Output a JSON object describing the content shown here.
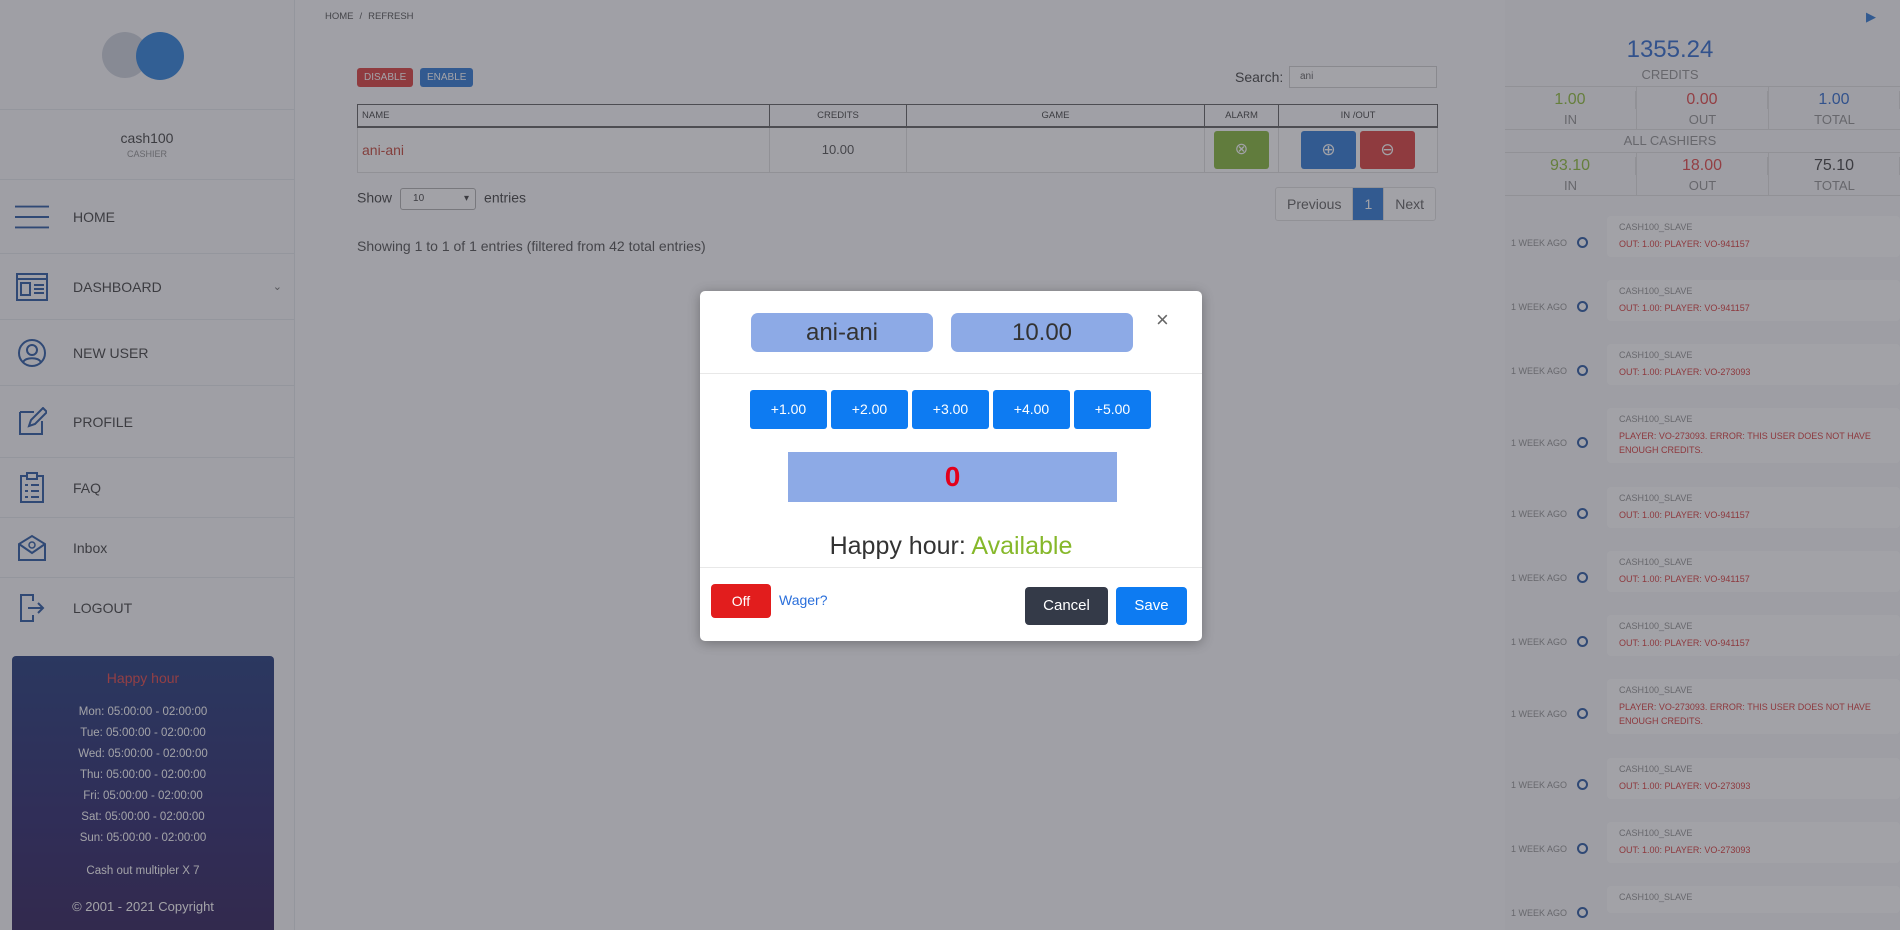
{
  "sidebar": {
    "username": "cash100",
    "role": "CASHIER",
    "nav": [
      {
        "label": "HOME",
        "icon": "menu-icon"
      },
      {
        "label": "DASHBOARD",
        "icon": "dashboard-icon"
      },
      {
        "label": "NEW USER",
        "icon": "user-icon"
      },
      {
        "label": "PROFILE",
        "icon": "edit-icon"
      },
      {
        "label": "FAQ",
        "icon": "clipboard-icon"
      },
      {
        "label": "Inbox",
        "icon": "mail-icon"
      },
      {
        "label": "LOGOUT",
        "icon": "logout-icon"
      }
    ],
    "happy_hour": {
      "title": "Happy hour",
      "days": [
        "Mon: 05:00:00 - 02:00:00",
        "Tue: 05:00:00 - 02:00:00",
        "Wed: 05:00:00 - 02:00:00",
        "Thu: 05:00:00 - 02:00:00",
        "Fri: 05:00:00 - 02:00:00",
        "Sat: 05:00:00 - 02:00:00",
        "Sun: 05:00:00 - 02:00:00"
      ],
      "multiplier": "Cash out multipler X 7",
      "copyright": "© 2001 - 2021 Copyright"
    }
  },
  "breadcrumb": {
    "home": "HOME",
    "sep": "/",
    "refresh": "REFRESH"
  },
  "toolbar": {
    "disable": "DISABLE",
    "enable": "ENABLE",
    "search_label": "Search:",
    "search_value": "ani"
  },
  "table": {
    "columns": [
      "NAME",
      "CREDITS",
      "GAME",
      "ALARM",
      "IN /OUT"
    ],
    "rows": [
      {
        "name": "ani-ani",
        "credits": "10.00",
        "game": ""
      }
    ]
  },
  "length": {
    "show": "Show",
    "value": "10",
    "entries": "entries"
  },
  "info": "Showing 1 to 1 of 1 entries (filtered from 42 total entries)",
  "pager": {
    "prev": "Previous",
    "page": "1",
    "next": "Next"
  },
  "balance": {
    "value": "1355.24",
    "label": "CREDITS",
    "row1": [
      {
        "v": "1.00",
        "k": "IN",
        "color": "#86b82a"
      },
      {
        "v": "0.00",
        "k": "OUT",
        "color": "#e03838"
      },
      {
        "v": "1.00",
        "k": "TOTAL",
        "color": "#1f5fc9"
      }
    ],
    "all_label": "ALL CASHIERS",
    "row2": [
      {
        "v": "93.10",
        "k": "IN",
        "color": "#86b82a"
      },
      {
        "v": "18.00",
        "k": "OUT",
        "color": "#e03838"
      },
      {
        "v": "75.10",
        "k": "TOTAL",
        "color": "#333333"
      }
    ]
  },
  "timeline": [
    {
      "time": "1 WEEK AGO",
      "head": "CASH100_SLAVE",
      "msg": "OUT: 1.00: PLAYER: VO-941157"
    },
    {
      "time": "1 WEEK AGO",
      "head": "CASH100_SLAVE",
      "msg": "OUT: 1.00: PLAYER: VO-941157"
    },
    {
      "time": "1 WEEK AGO",
      "head": "CASH100_SLAVE",
      "msg": "OUT: 1.00: PLAYER: VO-273093"
    },
    {
      "time": "1 WEEK AGO",
      "head": "CASH100_SLAVE",
      "msg": "PLAYER: VO-273093. ERROR: THIS USER DOES NOT HAVE ENOUGH CREDITS."
    },
    {
      "time": "1 WEEK AGO",
      "head": "CASH100_SLAVE",
      "msg": "OUT: 1.00: PLAYER: VO-941157"
    },
    {
      "time": "1 WEEK AGO",
      "head": "CASH100_SLAVE",
      "msg": "OUT: 1.00: PLAYER: VO-941157"
    },
    {
      "time": "1 WEEK AGO",
      "head": "CASH100_SLAVE",
      "msg": "OUT: 1.00: PLAYER: VO-941157"
    },
    {
      "time": "1 WEEK AGO",
      "head": "CASH100_SLAVE",
      "msg": "PLAYER: VO-273093. ERROR: THIS USER DOES NOT HAVE ENOUGH CREDITS."
    },
    {
      "time": "1 WEEK AGO",
      "head": "CASH100_SLAVE",
      "msg": "OUT: 1.00: PLAYER: VO-273093"
    },
    {
      "time": "1 WEEK AGO",
      "head": "CASH100_SLAVE",
      "msg": "OUT: 1.00: PLAYER: VO-273093"
    },
    {
      "time": "1 WEEK AGO",
      "head": "CASH100_SLAVE",
      "msg": ""
    }
  ],
  "modal": {
    "player": "ani-ani",
    "credits": "10.00",
    "adds": [
      "+1.00",
      "+2.00",
      "+3.00",
      "+4.00",
      "+5.00"
    ],
    "amount": "0",
    "happy_label": "Happy hour:",
    "happy_status": "Available",
    "off": "Off",
    "wager": "Wager?",
    "cancel": "Cancel",
    "save": "Save"
  }
}
